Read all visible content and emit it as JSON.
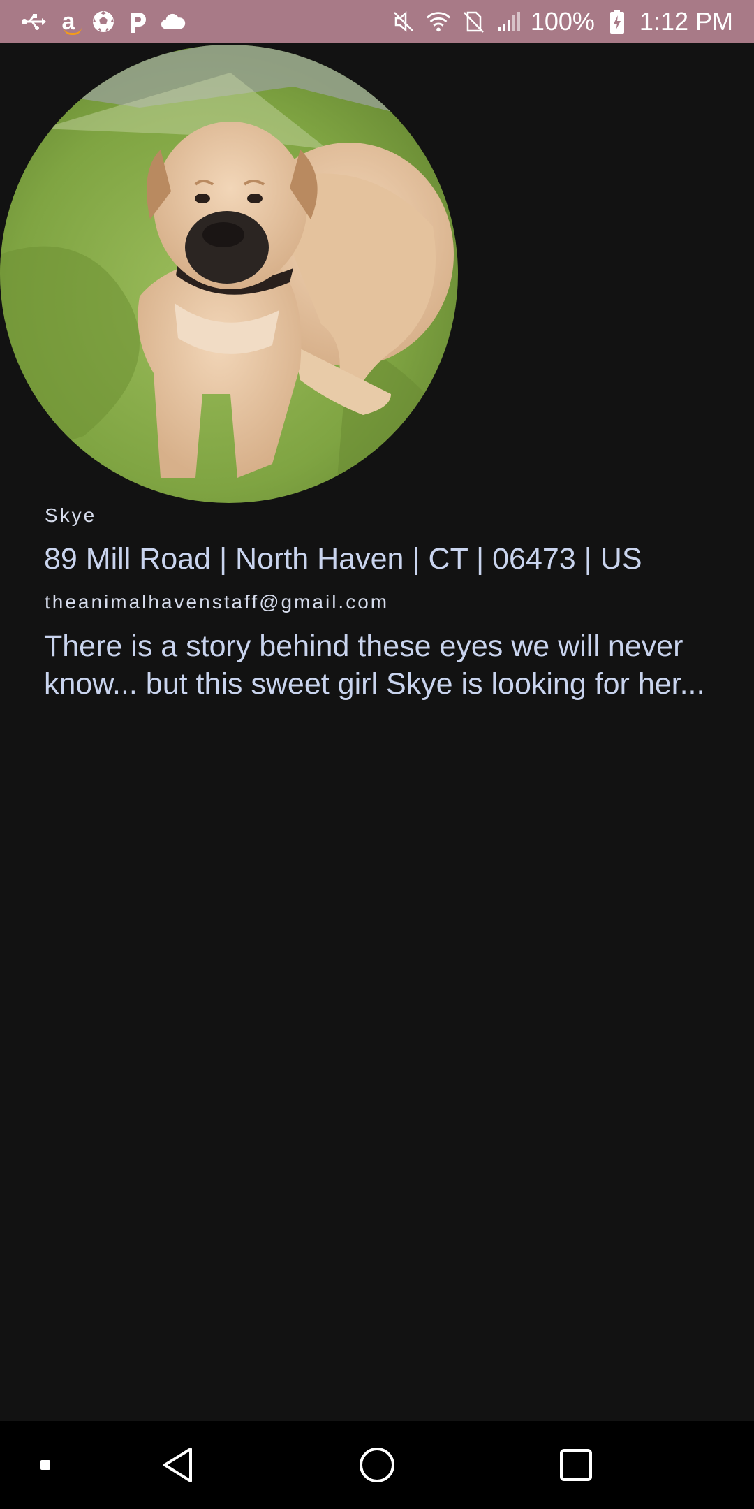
{
  "status_bar": {
    "battery": "100%",
    "time": "1:12 PM",
    "background_color": "#a87a87",
    "left_icons": [
      "usb-icon",
      "amazon-icon",
      "soccer-ball-icon",
      "pandora-icon",
      "cloud-icon"
    ],
    "right_icons": [
      "mute-icon",
      "wifi-icon",
      "no-sim-icon",
      "signal-icon",
      "battery-charging-icon"
    ]
  },
  "pet": {
    "photo": "dog-photo",
    "name": "Skye",
    "address": "89 Mill Road | North Haven | CT | 06473 | US",
    "email": "theanimalhavenstaff@gmail.com",
    "description": "There is a story behind these eyes we will never know... but this sweet girl Skye is looking for her..."
  },
  "nav_bar": {
    "buttons": [
      "dot-icon",
      "back-icon",
      "home-icon",
      "recents-icon"
    ]
  },
  "colors": {
    "background": "#121212",
    "text_primary": "#c9d4ee",
    "nav_background": "#000000"
  }
}
